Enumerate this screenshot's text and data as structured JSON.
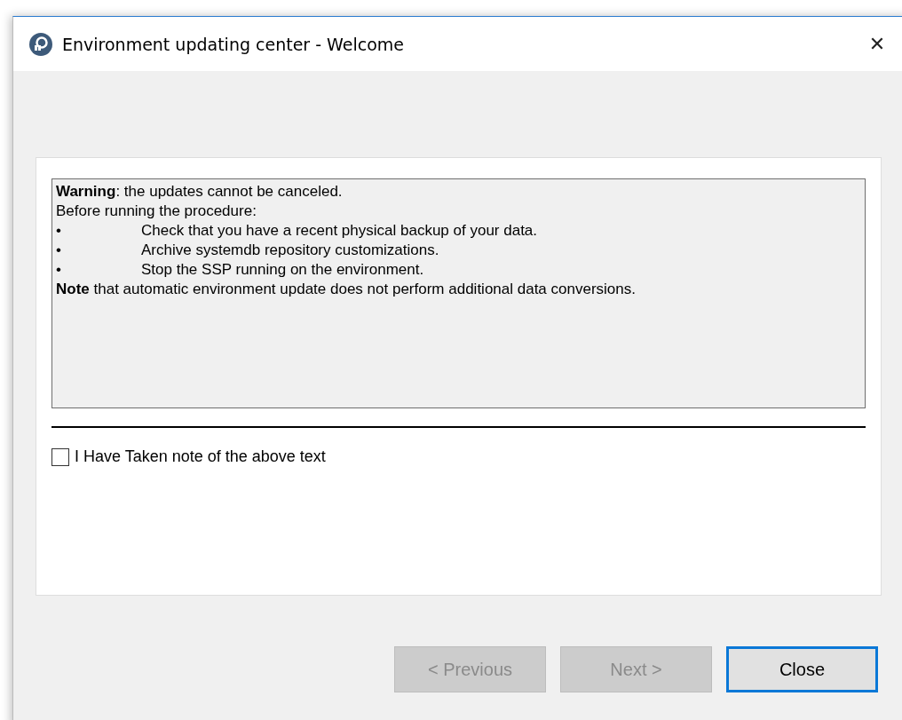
{
  "window": {
    "title": "Environment updating center - Welcome",
    "close": "✕"
  },
  "notice": [
    {
      "kind": "text",
      "text": "**Warning**: the updates cannot be canceled."
    },
    {
      "kind": "text",
      "text": "Before running the procedure:"
    },
    {
      "kind": "bullet",
      "bullet": "•",
      "text": "Check that you have a recent physical backup of your data."
    },
    {
      "kind": "bullet",
      "bullet": "•",
      "text": "Archive systemdb repository customizations."
    },
    {
      "kind": "bullet",
      "bullet": "•",
      "text": "Stop the SSP running on the environment."
    },
    {
      "kind": "text",
      "text": "**Note** that automatic environment update does not perform additional data conversions."
    }
  ],
  "acknowledge": {
    "label": "I Have Taken note of the above text",
    "checked": false
  },
  "buttons": [
    {
      "label": "< Previous",
      "disabled": true,
      "focused": false
    },
    {
      "label": "Next >",
      "disabled": true,
      "focused": false
    },
    {
      "label": "Close",
      "disabled": false,
      "focused": true
    }
  ]
}
